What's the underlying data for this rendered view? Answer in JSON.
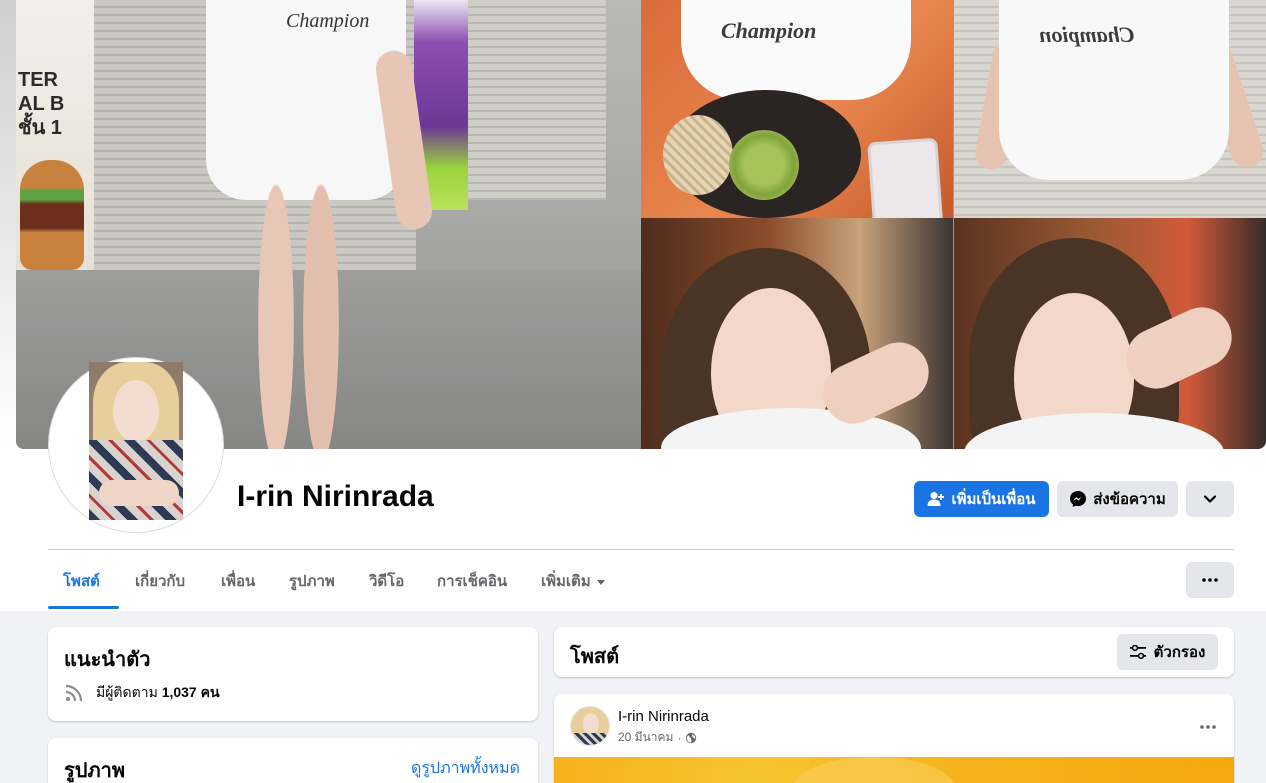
{
  "profile": {
    "name": "I-rin Nirinrada"
  },
  "cover": {
    "poster_text": "TER\nAL B\nชั้น 1",
    "shirt_logo": "Champion"
  },
  "actions": {
    "add_friend": "เพิ่มเป็นเพื่อน",
    "message": "ส่งข้อความ",
    "more_icon": "chevron-down-icon",
    "dots_icon": "more-dots-icon"
  },
  "tabs": [
    {
      "label": "โพสต์",
      "active": true
    },
    {
      "label": "เกี่ยวกับ",
      "active": false
    },
    {
      "label": "เพื่อน",
      "active": false
    },
    {
      "label": "รูปภาพ",
      "active": false
    },
    {
      "label": "วิดีโอ",
      "active": false
    },
    {
      "label": "การเช็คอิน",
      "active": false
    },
    {
      "label": "เพิ่มเติม",
      "active": false
    }
  ],
  "intro": {
    "title": "แนะนำตัว",
    "followers_prefix": "มีผู้ติดตาม",
    "followers_count": "1,037 คน"
  },
  "photos": {
    "title": "รูปภาพ",
    "see_all": "ดูรูปภาพทั้งหมด"
  },
  "posts": {
    "title": "โพสต์",
    "filter_label": "ตัวกรอง"
  },
  "post": {
    "author": "I-rin Nirinrada",
    "date": "20 มีนาคม",
    "separator": "·",
    "privacy_icon": "globe-icon"
  },
  "colors": {
    "accent": "#1b74e4",
    "secondary_button": "#e4e6eb",
    "page_background": "#f0f2f5",
    "muted_text": "#65676b"
  }
}
